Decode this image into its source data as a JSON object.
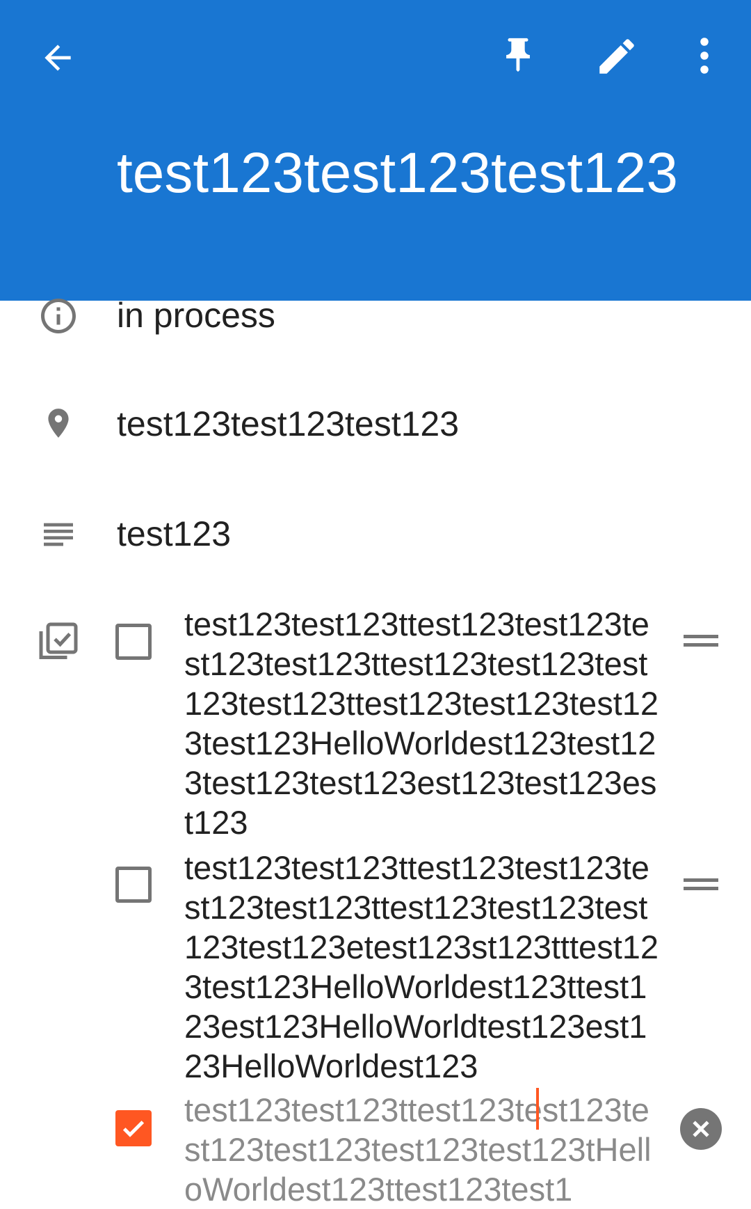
{
  "header": {
    "title": "test123test123test123"
  },
  "details": {
    "status": "in process",
    "location": "test123test123test123",
    "description": "test123"
  },
  "checklist": [
    {
      "checked": false,
      "text": "test123test123ttest123test123test123test123ttest123test123test123test123ttest123test123test123test123HelloWorldest123test123test123test123est123test123est123"
    },
    {
      "checked": false,
      "text": "test123test123ttest123test123test123test123ttest123test123test123test123etest123st123tttest123test123HelloWorldest123ttest123est123HelloWorldtest123est123HelloWorldest123"
    },
    {
      "checked": true,
      "text": "test123test123ttest123test123test123test123test123test123tHelloWorldest123ttest123test1"
    }
  ],
  "colors": {
    "appbar": "#1976D2",
    "accent": "#FF5722",
    "icon": "#757575"
  }
}
